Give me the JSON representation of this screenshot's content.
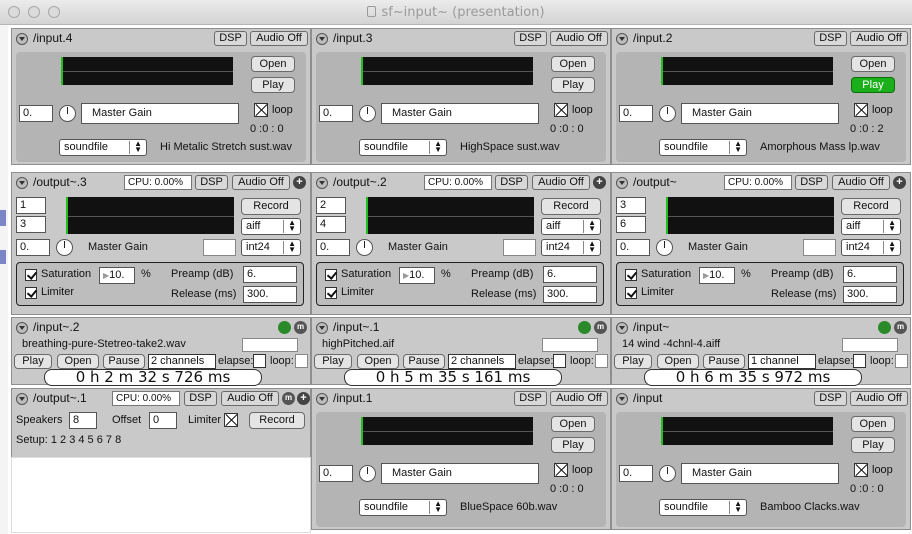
{
  "window_title": "sf~input~ (presentation)",
  "common": {
    "dsp": "DSP",
    "audio_off": "Audio Off",
    "open": "Open",
    "play": "Play",
    "loop": "loop",
    "master_gain": "Master Gain",
    "gain_value": "0.",
    "soundfile": "soundfile",
    "record": "Record",
    "format": "aiff",
    "bitdepth": "int24",
    "saturation": "Saturation",
    "limiter": "Limiter",
    "percent": "%",
    "preamp": "Preamp (dB)",
    "release": "Release (ms)",
    "preamp_val": "6.",
    "release_val": "300.",
    "sat_val": "10.",
    "pause": "Pause",
    "elapse": "elapse:",
    "loop_colon": "loop:",
    "plus": "+",
    "m": "m"
  },
  "inputs": [
    {
      "name": "/input.4",
      "time": "0  :0  : 0",
      "file": "Hi Metalic Stretch sust.wav",
      "playing": false
    },
    {
      "name": "/input.3",
      "time": "0  :0  : 0",
      "file": "HighSpace sust.wav",
      "playing": false
    },
    {
      "name": "/input.2",
      "time": "0  :0  : 2",
      "file": "Amorphous Mass lp.wav",
      "playing": true
    },
    {
      "name": "/input.1",
      "time": "0  :0  : 0",
      "file": "BlueSpace 60b.wav",
      "playing": false
    },
    {
      "name": "/input",
      "time": "0  :0  : 0",
      "file": "Bamboo Clacks.wav",
      "playing": false
    }
  ],
  "outputs": [
    {
      "name": "/output~.3",
      "cpu": "CPU: 0.00%",
      "ch1": "1",
      "ch2": "3"
    },
    {
      "name": "/output~.2",
      "cpu": "CPU: 0.00%",
      "ch1": "2",
      "ch2": "4"
    },
    {
      "name": "/output~",
      "cpu": "CPU: 0.00%",
      "ch1": "3",
      "ch2": "6"
    }
  ],
  "players": [
    {
      "name": "/input~.2",
      "file": "breathing-pure-Stetreo-take2.wav",
      "channels": "2 channels",
      "timer": "0  h 2    m  32 s  726   ms"
    },
    {
      "name": "/input~.1",
      "file": "highPitched.aif",
      "channels": "2 channels",
      "timer": "0  h 5    m  35 s  161   ms"
    },
    {
      "name": "/input~",
      "file": "14 wind -4chnl-4.aiff",
      "channels": "1 channel",
      "timer": "0  h 6    m  35 s  972   ms"
    }
  ],
  "multi_out": {
    "name": "/output~.1",
    "cpu": "CPU: 0.00%",
    "speakers_label": "Speakers",
    "speakers": "8",
    "offset_label": "Offset",
    "offset": "0",
    "limiter_label": "Limiter",
    "setup": "Setup: 1 2 3 4 5 6 7 8"
  }
}
